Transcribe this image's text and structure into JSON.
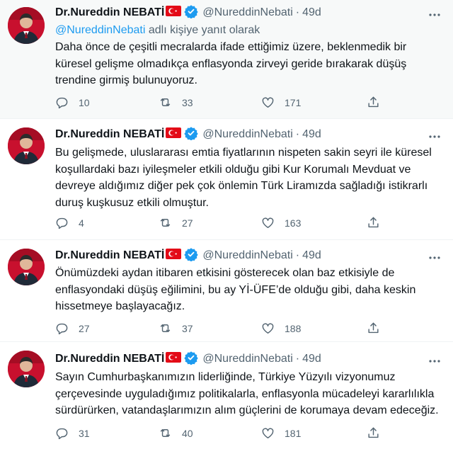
{
  "tweets": [
    {
      "name": "Dr.Nureddin NEBATİ",
      "handle": "@NureddinNebati",
      "dot": "·",
      "time": "49d",
      "reply_prefix": "@NureddinNebati",
      "reply_suffix": " adlı kişiye yanıt olarak",
      "lines": [
        "Daha önce de çeşitli mecralarda ifade ettiğimiz üzere, beklenmedik bir",
        "küresel gelişme olmadıkça enflasyonda zirveyi geride bırakarak düşüş",
        "trendine girmiş bulunuyoruz."
      ],
      "replies": "10",
      "retweets": "33",
      "likes": "171"
    },
    {
      "name": "Dr.Nureddin NEBATİ",
      "handle": "@NureddinNebati",
      "dot": "·",
      "time": "49d",
      "lines": [
        "Bu gelişmede, uluslararası emtia fiyatlarının nispeten sakin seyri ile küresel",
        "koşullardaki bazı iyileşmeler etkili olduğu gibi Kur Korumalı Mevduat ve",
        "devreye aldığımız diğer pek çok önlemin Türk Liramızda sağladığı istikrarlı",
        "duruş kuşkusuz etkili olmuştur."
      ],
      "replies": "4",
      "retweets": "27",
      "likes": "163"
    },
    {
      "name": "Dr.Nureddin NEBATİ",
      "handle": "@NureddinNebati",
      "dot": "·",
      "time": "49d",
      "lines": [
        "Önümüzdeki aydan itibaren etkisini gösterecek olan baz etkisiyle de",
        "enflasyondaki düşüş eğilimini, bu ay Yİ-ÜFE’de olduğu gibi, daha keskin",
        "hissetmeye başlayacağız."
      ],
      "replies": "27",
      "retweets": "37",
      "likes": "188"
    },
    {
      "name": "Dr.Nureddin NEBATİ",
      "handle": "@NureddinNebati",
      "dot": "·",
      "time": "49d",
      "lines": [
        "Sayın Cumhurbaşkanımızın liderliğinde, Türkiye Yüzyılı vizyonumuz",
        "çerçevesinde uyguladığımız politikalarla, enflasyonla mücadeleyi kararlılıkla",
        "sürdürürken, vatandaşlarımızın alım güçlerini de korumaya devam edeceğiz."
      ],
      "replies": "31",
      "retweets": "40",
      "likes": "181"
    }
  ],
  "icons": {
    "more": "more-icon",
    "reply": "reply-icon",
    "retweet": "retweet-icon",
    "like": "heart-icon",
    "share": "share-icon",
    "verified": "verified-badge-icon",
    "flag": "turkey-flag-icon"
  },
  "colors": {
    "text": "#0f1419",
    "secondary": "#536471",
    "link": "#1d9bf0",
    "verified": "#1d9bf0",
    "flag": "#e30a17",
    "highlight_bg": "#f7f9f9"
  }
}
